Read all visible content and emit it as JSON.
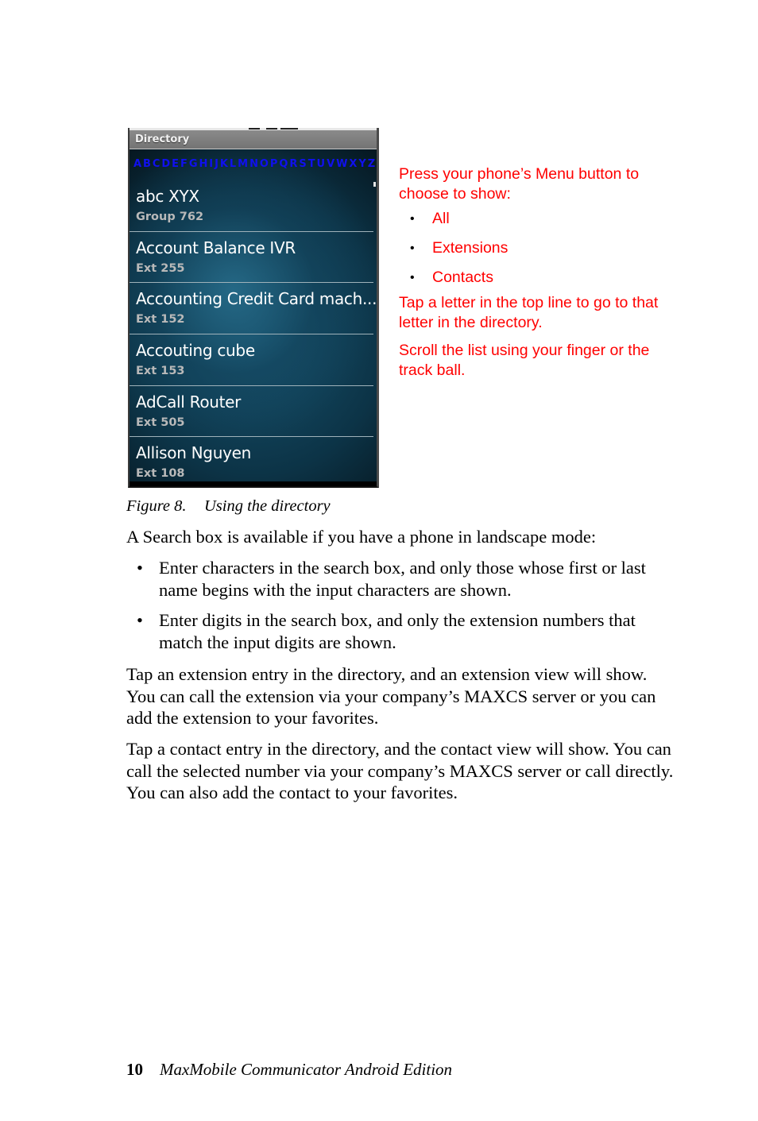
{
  "phone": {
    "title": "Directory",
    "alphabet": [
      "A",
      "B",
      "C",
      "D",
      "E",
      "F",
      "G",
      "H",
      "I",
      "J",
      "K",
      "L",
      "M",
      "N",
      "O",
      "P",
      "Q",
      "R",
      "S",
      "T",
      "U",
      "V",
      "W",
      "X",
      "Y",
      "Z"
    ],
    "accent_color": "#1010ee",
    "entries": [
      {
        "name": "abc  XYX",
        "sub": "Group 762"
      },
      {
        "name": "Account Balance IVR",
        "sub": "Ext 255"
      },
      {
        "name": "Accounting Credit Card mach...",
        "sub": "Ext 152"
      },
      {
        "name": "Accouting cube",
        "sub": "Ext 153"
      },
      {
        "name": "AdCall Router",
        "sub": "Ext 505"
      },
      {
        "name": "Allison Nguyen",
        "sub": "Ext 108"
      }
    ]
  },
  "callout": {
    "color": "#ff0000",
    "intro": "Press your phone’s Menu button to choose to show:",
    "options": [
      "All",
      "Extensions",
      "Contacts"
    ],
    "tap_letter": "Tap a letter in the top line to go to that letter in the directory.",
    "scroll": "Scroll the list using your finger or the track ball."
  },
  "figure": {
    "label": "Figure 8.",
    "caption": "Using the directory"
  },
  "body": {
    "intro": "A Search box is available if you have a phone in landscape mode:",
    "bullets": [
      "Enter characters in the search box, and only those whose first or last name begins with the input characters are shown.",
      "Enter digits in the search box, and only the extension numbers that match the input digits are shown."
    ],
    "para_extension": "Tap an extension entry in the directory, and an extension view will show. You can call the extension via your company’s MAXCS server or you can add the extension to your favorites.",
    "para_contact": "Tap a contact entry in the directory, and the contact view will show. You can call the selected number via your company’s MAXCS server or call directly. You can also add the contact to your favorites."
  },
  "footer": {
    "page_number": "10",
    "doc_title": "MaxMobile Communicator Android Edition"
  }
}
